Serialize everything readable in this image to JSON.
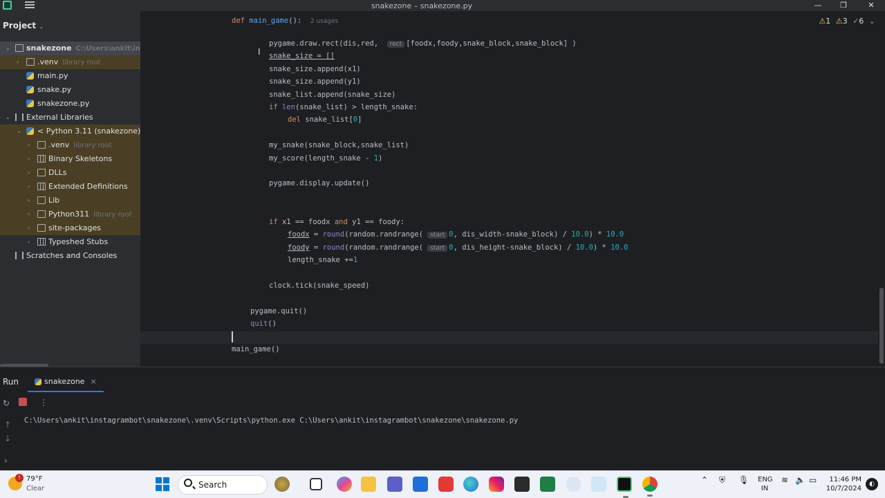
{
  "window": {
    "title": "snakezone – snakezone.py",
    "minimize": "—",
    "maximize": "❐",
    "close": "✕"
  },
  "project": {
    "header": "Project",
    "root": {
      "name": "snakezone",
      "path": "C:\\Users\\ankit\\in"
    },
    "items": [
      {
        "label": ".venv",
        "hint": "library root"
      },
      {
        "label": "main.py"
      },
      {
        "label": "snake.py"
      },
      {
        "label": "snakezone.py"
      },
      {
        "label": "External Libraries"
      },
      {
        "label": "< Python 3.11 (snakezone) >"
      },
      {
        "label": ".venv",
        "hint": "library root"
      },
      {
        "label": "Binary Skeletons"
      },
      {
        "label": "DLLs"
      },
      {
        "label": "Extended Definitions"
      },
      {
        "label": "Lib"
      },
      {
        "label": "Python311",
        "hint": "library root"
      },
      {
        "label": "site-packages"
      },
      {
        "label": "Typeshed Stubs"
      },
      {
        "label": "Scratches and Consoles"
      }
    ]
  },
  "editor": {
    "inspections": {
      "warnings": "1",
      "weak": "3",
      "typos": "6"
    },
    "usages_hint": "2 usages",
    "param_hints": {
      "rect": "rect",
      "start": "start"
    }
  },
  "run": {
    "label": "Run",
    "tab": "snakezone",
    "close": "×",
    "console": "C:\\Users\\ankit\\instagrambot\\snakezone\\.venv\\Scripts\\python.exe C:\\Users\\ankit\\instagrambot\\snakezone\\snakezone.py"
  },
  "taskbar": {
    "temperature": "79°F",
    "condition": "Clear",
    "search": "Search",
    "lang1": "ENG",
    "lang2": "IN",
    "time": "11:46 PM",
    "date": "10/7/2024"
  },
  "colors": {
    "accent": "#3574f0",
    "keyword": "#cf8e6d",
    "function": "#56a8f5",
    "number": "#2aacb8"
  }
}
